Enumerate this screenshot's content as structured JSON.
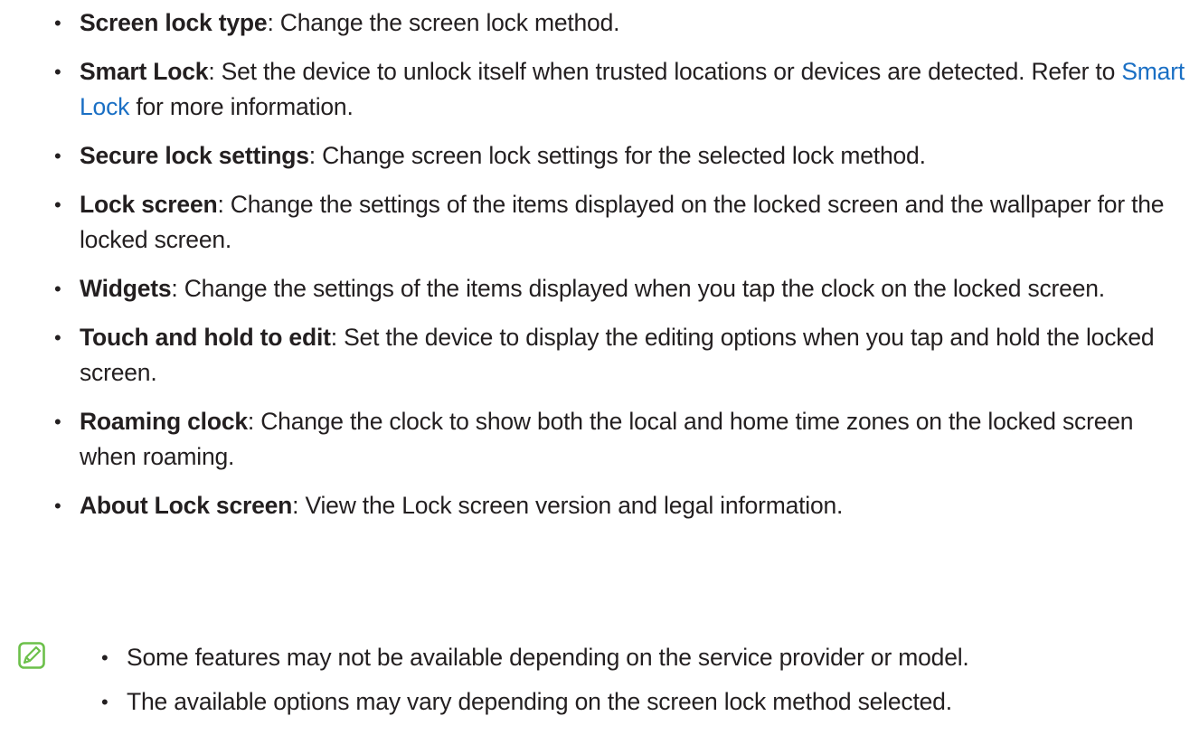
{
  "items": [
    {
      "term": "Screen lock type",
      "sep": ": ",
      "desc": "Change the screen lock method."
    },
    {
      "term": "Smart Lock",
      "sep": ": ",
      "desc_before": "Set the device to unlock itself when trusted locations or devices are detected. Refer to ",
      "link": "Smart Lock",
      "desc_after": " for more information."
    },
    {
      "term": "Secure lock settings",
      "sep": ": ",
      "desc": "Change screen lock settings for the selected lock method."
    },
    {
      "term": "Lock screen",
      "sep": ": ",
      "desc": "Change the settings of the items displayed on the locked screen and the wallpaper for the locked screen."
    },
    {
      "term": "Widgets",
      "sep": ": ",
      "desc": "Change the settings of the items displayed when you tap the clock on the locked screen."
    },
    {
      "term": "Touch and hold to edit",
      "sep": ": ",
      "desc": "Set the device to display the editing options when you tap and hold the locked screen."
    },
    {
      "term": "Roaming clock",
      "sep": ": ",
      "desc": "Change the clock to show both the local and home time zones on the locked screen when roaming."
    },
    {
      "term": "About Lock screen",
      "sep": ": ",
      "desc": "View the Lock screen version and legal information."
    }
  ],
  "bullet_char": "•",
  "note": {
    "icon": "note-pencil-icon",
    "accent_color": "#6cc04a",
    "items": [
      "Some features may not be available depending on the service provider or model.",
      "The available options may vary depending on the screen lock method selected."
    ]
  },
  "link_color": "#1a6fc4"
}
